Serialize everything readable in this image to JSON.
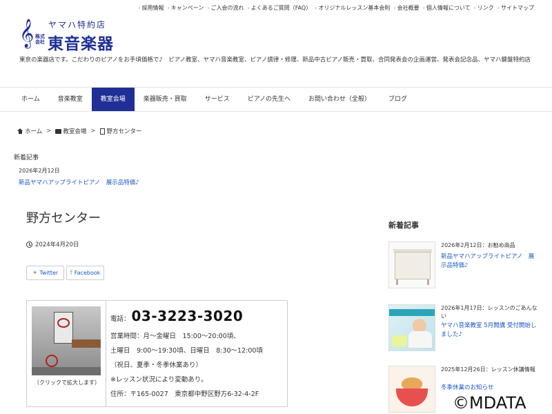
{
  "top_links": [
    "採用情報",
    "キャンペーン",
    "ご入会の流れ",
    "よくあるご質問（FAQ）",
    "オリジナルレッスン基本会則",
    "会社概要",
    "個人情報について",
    "リンク",
    "サイトマップ"
  ],
  "logo": {
    "tagline": "ヤマハ特約店",
    "kaisha": "株式会社",
    "name": "東音楽器",
    "clef": "𝄞"
  },
  "site_description": "東京の楽器店です。こだわりのピアノをお手頃価格で♪　ピアノ教室、ヤマハ音楽教室、ピアノ調律・修理、新品中古ピアノ販売・買取、合同発表会の企画運営、発表会記念品、ヤマハ鍵盤特約店",
  "nav": [
    "ホーム",
    "音楽教室",
    "教室会場",
    "楽器販売・買取",
    "サービス",
    "ピアノの先生へ",
    "お問い合わせ（全般）",
    "ブログ"
  ],
  "nav_active_index": 2,
  "breadcrumb": [
    "ホーム",
    "教室会場",
    "野方センター"
  ],
  "breadcrumb_sep": ">",
  "news_bar": {
    "heading": "新着記事",
    "date": "2026年2月12日",
    "title": "新品ヤマハアップライトピアノ　展示品特価♪"
  },
  "article": {
    "title": "野方センター",
    "date": "2024年4月20日",
    "share": {
      "twitter": "Twitter",
      "facebook": "Facebook"
    },
    "photo_caption": "（クリックで拡大します）",
    "tel_label": "電話：",
    "tel": "03-3223-3020",
    "hours": [
      "営業時間：月～金曜日　15:00～20:00頃、",
      "土曜日　9:00～19:30頃、日曜日　8:30～12:00頃",
      "（祝日、夏季・冬季休業あり）",
      "※レッスン状況により変動あり。",
      "住所：〒165-0027　東京都中野区野方6-32-4-2F"
    ]
  },
  "sidebar": {
    "heading": "新着記事",
    "items": [
      {
        "meta": "2026年2月12日：お勧め商品",
        "title": "新品ヤマハアップライトピアノ　展示品特価♪"
      },
      {
        "meta": "2026年1月17日：レッスンのごあんない",
        "title": "ヤマハ音楽教室 5月開講 受付開始しました♪"
      },
      {
        "meta": "2025年12月26日：レッスン休講情報",
        "title": "冬季休業のお知らせ"
      }
    ]
  },
  "watermark": "©MDATA",
  "colors": {
    "brand": "#1f2f96",
    "link": "#1a55c4",
    "nav_active_bg": "#1f2f96"
  }
}
